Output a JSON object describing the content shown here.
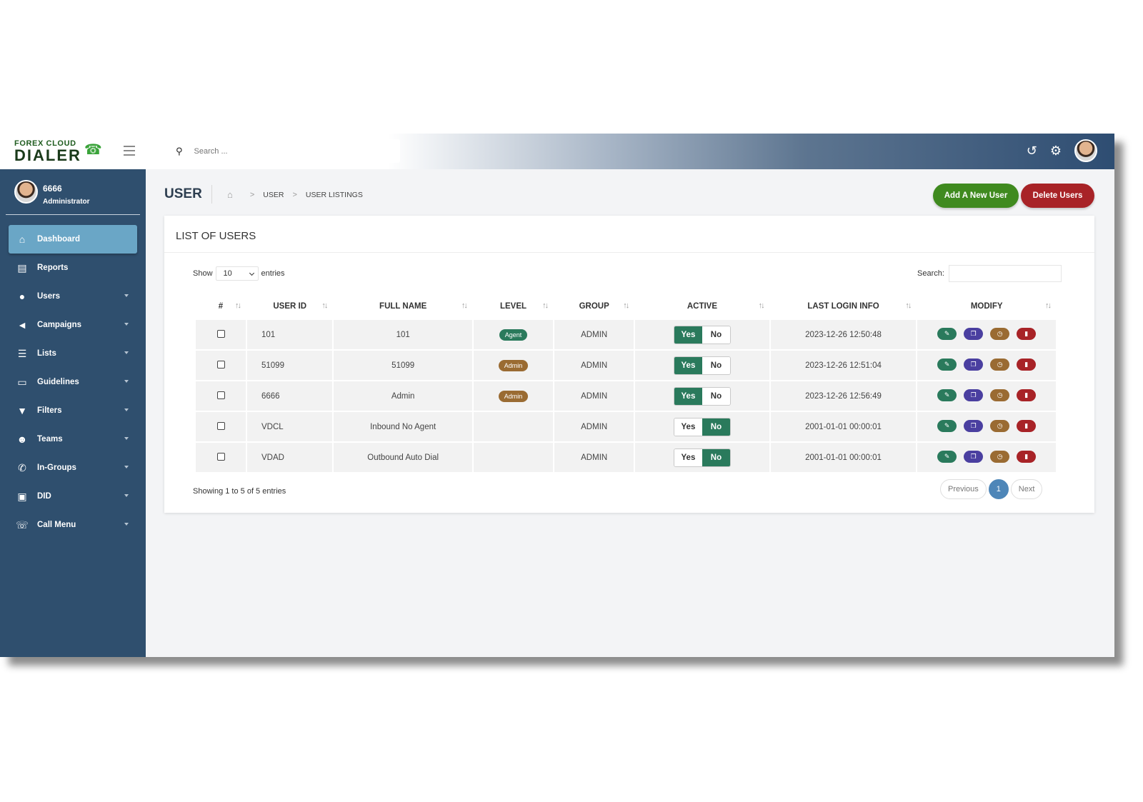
{
  "brand": {
    "top": "FOREX CLOUD",
    "main": "DIALER"
  },
  "header": {
    "search_placeholder": "Search ...",
    "icons": [
      "history-icon",
      "settings-icon",
      "avatar"
    ]
  },
  "sidebar": {
    "user": {
      "name": "6666",
      "role": "Administrator"
    },
    "items": [
      {
        "label": "Dashboard",
        "icon": "home-icon",
        "glyph": "⌂"
      },
      {
        "label": "Reports",
        "icon": "file-icon",
        "glyph": "▤"
      },
      {
        "label": "Users",
        "icon": "user-icon",
        "glyph": "●"
      },
      {
        "label": "Campaigns",
        "icon": "bullhorn-icon",
        "glyph": "◄"
      },
      {
        "label": "Lists",
        "icon": "list-icon",
        "glyph": "☰"
      },
      {
        "label": "Guidelines",
        "icon": "card-icon",
        "glyph": "▭"
      },
      {
        "label": "Filters",
        "icon": "filter-icon",
        "glyph": "▼"
      },
      {
        "label": "Teams",
        "icon": "users-icon",
        "glyph": "☻"
      },
      {
        "label": "In-Groups",
        "icon": "phone-icon",
        "glyph": "✆"
      },
      {
        "label": "DID",
        "icon": "phone-square-icon",
        "glyph": "▣"
      },
      {
        "label": "Call Menu",
        "icon": "phone-volume-icon",
        "glyph": "☏"
      }
    ]
  },
  "page": {
    "title": "USER",
    "breadcrumb": [
      "USER",
      "USER LISTINGS"
    ],
    "add_button": "Add A New User",
    "delete_button": "Delete Users"
  },
  "card": {
    "title": "LIST OF USERS",
    "show_label": "Show",
    "entries_label": "entries",
    "page_size": "10",
    "search_label": "Search:",
    "showing": "Showing 1 to 5 of 5 entries",
    "pager": {
      "prev": "Previous",
      "current": "1",
      "next": "Next"
    }
  },
  "table": {
    "columns": [
      "#",
      "USER ID",
      "FULL NAME",
      "LEVEL",
      "GROUP",
      "ACTIVE",
      "LAST LOGIN INFO",
      "MODIFY"
    ],
    "toggle_labels": {
      "yes": "Yes",
      "no": "No"
    },
    "rows": [
      {
        "user_id": "101",
        "full_name": "101",
        "level": "Agent",
        "level_color": "#2a7a5c",
        "group": "ADMIN",
        "active": "Yes",
        "last_login": "2023-12-26 12:50:48"
      },
      {
        "user_id": "51099",
        "full_name": "51099",
        "level": "Admin",
        "level_color": "#9a6b32",
        "group": "ADMIN",
        "active": "Yes",
        "last_login": "2023-12-26 12:51:04"
      },
      {
        "user_id": "6666",
        "full_name": "Admin",
        "level": "Admin",
        "level_color": "#9a6b32",
        "group": "ADMIN",
        "active": "Yes",
        "last_login": "2023-12-26 12:56:49"
      },
      {
        "user_id": "VDCL",
        "full_name": "Inbound No Agent",
        "level": "",
        "level_color": "",
        "group": "ADMIN",
        "active": "No",
        "last_login": "2001-01-01 00:00:01"
      },
      {
        "user_id": "VDAD",
        "full_name": "Outbound Auto Dial",
        "level": "",
        "level_color": "",
        "group": "ADMIN",
        "active": "No",
        "last_login": "2001-01-01 00:00:01"
      }
    ],
    "modify_actions": [
      {
        "name": "edit-icon",
        "color": "#2a7a5c",
        "glyph": "✎"
      },
      {
        "name": "copy-icon",
        "color": "#4a3fa0",
        "glyph": "❐"
      },
      {
        "name": "clock-icon",
        "color": "#9a6b32",
        "glyph": "◷"
      },
      {
        "name": "trash-icon",
        "color": "#a82327",
        "glyph": "▮"
      }
    ]
  },
  "colors": {
    "sidebar": "#2f4f6e",
    "active_nav": "#6aa6c6",
    "accent_green": "#3f8a1f",
    "danger": "#a82327",
    "toggle_on": "#2a7a5c",
    "pager_active": "#4e86b8"
  }
}
